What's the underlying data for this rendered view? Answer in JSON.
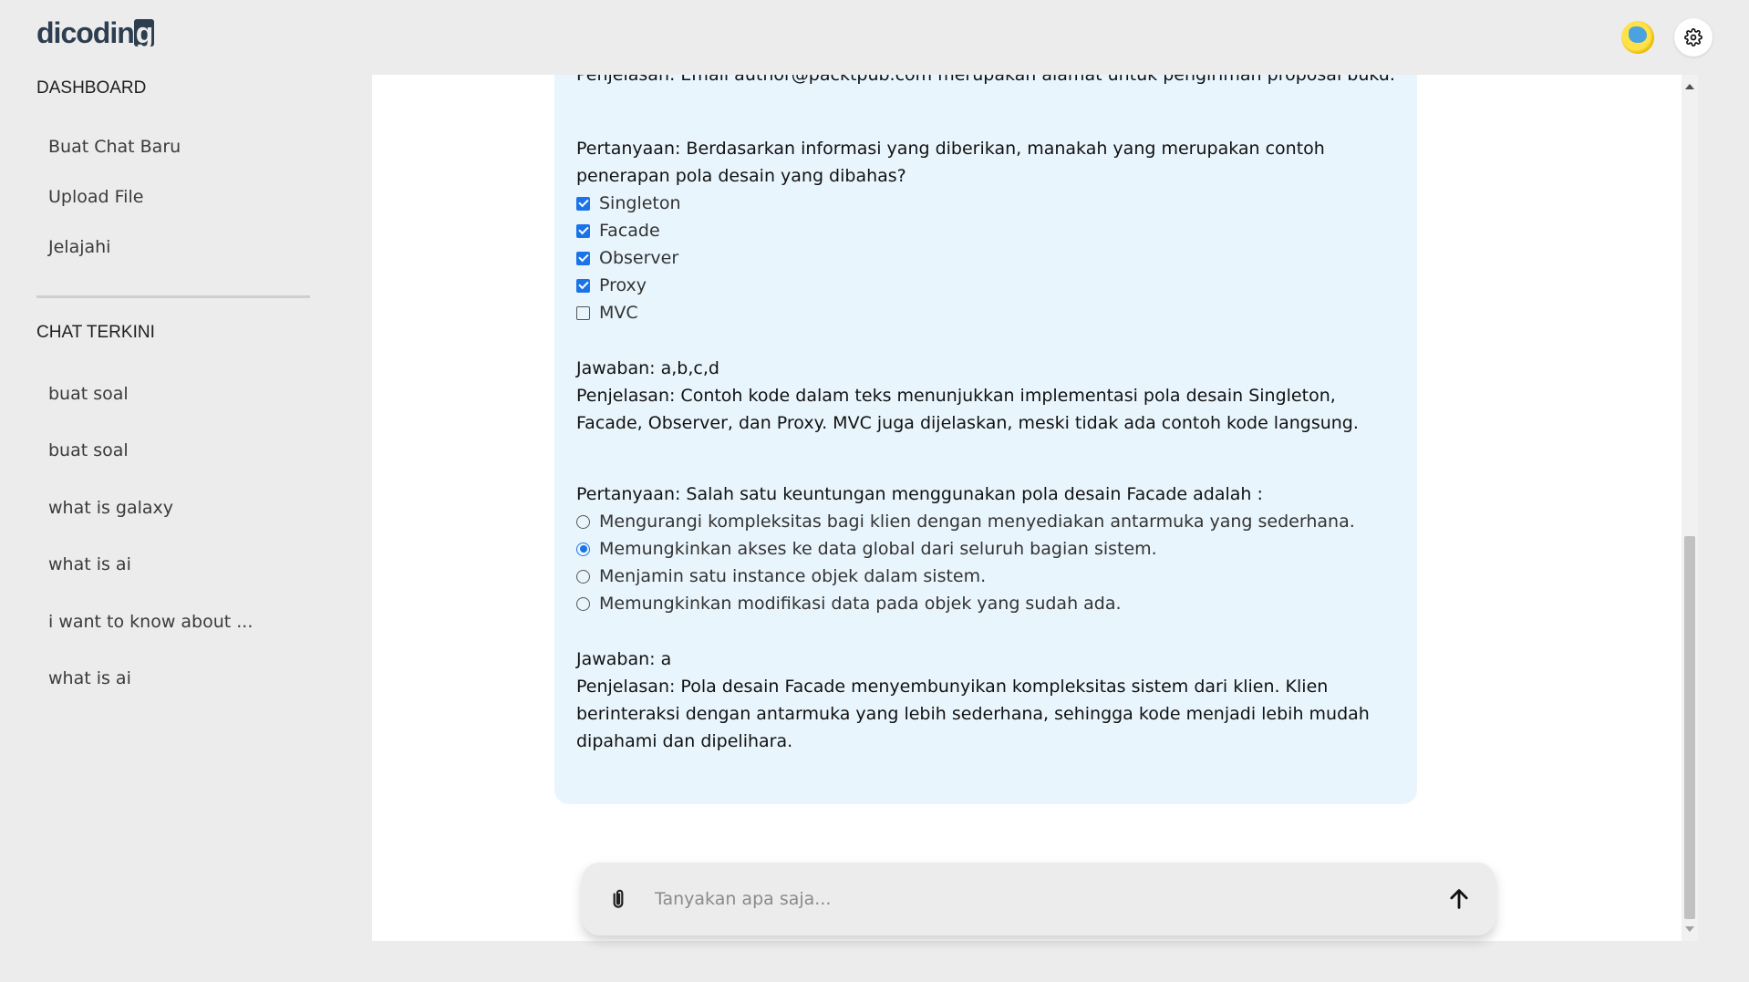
{
  "brand": {
    "logo_text": "dicodin",
    "logo_box": "g"
  },
  "header": {
    "avatar_icon": "avatar-icon",
    "settings_icon": "gear-icon"
  },
  "sidebar": {
    "dashboard_title": "DASHBOARD",
    "nav": [
      "Buat Chat Baru",
      "Upload File",
      "Jelajahi"
    ],
    "recent_title": "CHAT TERKINI",
    "recent": [
      "buat soal",
      "buat soal",
      "what is galaxy",
      "what is ai",
      "i want to know about ...",
      "what is ai"
    ]
  },
  "chat": {
    "partial_top": "Penjelasan: Email author@packtpub.com merupakan alamat untuk pengiriman proposal buku.",
    "q1": {
      "question": "Pertanyaan: Berdasarkan informasi yang diberikan, manakah yang merupakan contoh penerapan pola desain yang dibahas?",
      "options": [
        {
          "label": "Singleton",
          "checked": true
        },
        {
          "label": "Facade",
          "checked": true
        },
        {
          "label": "Observer",
          "checked": true
        },
        {
          "label": "Proxy",
          "checked": true
        },
        {
          "label": "MVC",
          "checked": false
        }
      ],
      "answer": "Jawaban: a,b,c,d",
      "explanation": "Penjelasan: Contoh kode dalam teks menunjukkan implementasi pola desain Singleton, Facade, Observer, dan Proxy. MVC juga dijelaskan, meski tidak ada contoh kode langsung."
    },
    "q2": {
      "question": "Pertanyaan: Salah satu keuntungan menggunakan pola desain Facade adalah :",
      "options": [
        {
          "label": "Mengurangi kompleksitas bagi klien dengan menyediakan antarmuka yang sederhana.",
          "selected": false
        },
        {
          "label": "Memungkinkan akses ke data global dari seluruh bagian sistem.",
          "selected": true
        },
        {
          "label": "Menjamin satu instance objek dalam sistem.",
          "selected": false
        },
        {
          "label": "Memungkinkan modifikasi data pada objek yang sudah ada.",
          "selected": false
        }
      ],
      "answer": "Jawaban: a",
      "explanation": "Penjelasan: Pola desain Facade menyembunyikan kompleksitas sistem dari klien. Klien berinteraksi dengan antarmuka yang lebih sederhana, sehingga kode menjadi lebih mudah dipahami dan dipelihara."
    }
  },
  "composer": {
    "placeholder": "Tanyakan apa saja...",
    "attach_icon": "paperclip-icon",
    "send_icon": "arrow-up-icon"
  },
  "colors": {
    "accent": "#1a73e8",
    "bubble": "#e9f5fd",
    "background": "#ececec"
  }
}
